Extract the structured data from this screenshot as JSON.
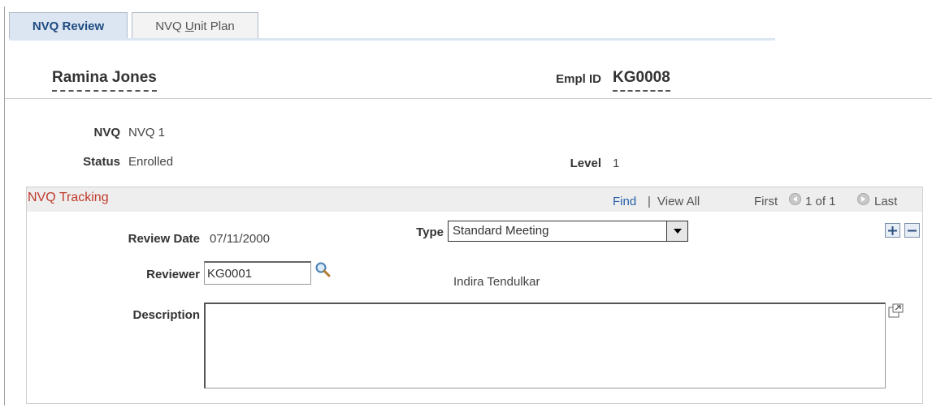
{
  "tabs": [
    {
      "label": "NVQ Review",
      "active": true
    },
    {
      "label_before": "NVQ ",
      "label_underline": "U",
      "label_after": "nit Plan",
      "active": false
    }
  ],
  "header": {
    "name": "Ramina Jones",
    "empl_id_label": "Empl ID",
    "empl_id_value": "KG0008"
  },
  "info": {
    "nvq_label": "NVQ",
    "nvq_value": "NVQ 1",
    "status_label": "Status",
    "status_value": "Enrolled",
    "level_label": "Level",
    "level_value": "1"
  },
  "tracking": {
    "title": "NVQ Tracking",
    "find_label": "Find",
    "separator": "|",
    "view_all_label": "View All",
    "first_label": "First",
    "pagination": "1 of 1",
    "last_label": "Last",
    "review_date_label": "Review Date",
    "review_date_value": "07/11/2000",
    "type_label": "Type",
    "type_value": "Standard Meeting",
    "reviewer_label": "Reviewer",
    "reviewer_value": "KG0001",
    "reviewer_name": "Indira Tendulkar",
    "description_label": "Description",
    "description_value": ""
  },
  "colors": {
    "tab_active_bg": "#dbe6f2",
    "link": "#2860a8",
    "grid_title": "#c0392b"
  }
}
